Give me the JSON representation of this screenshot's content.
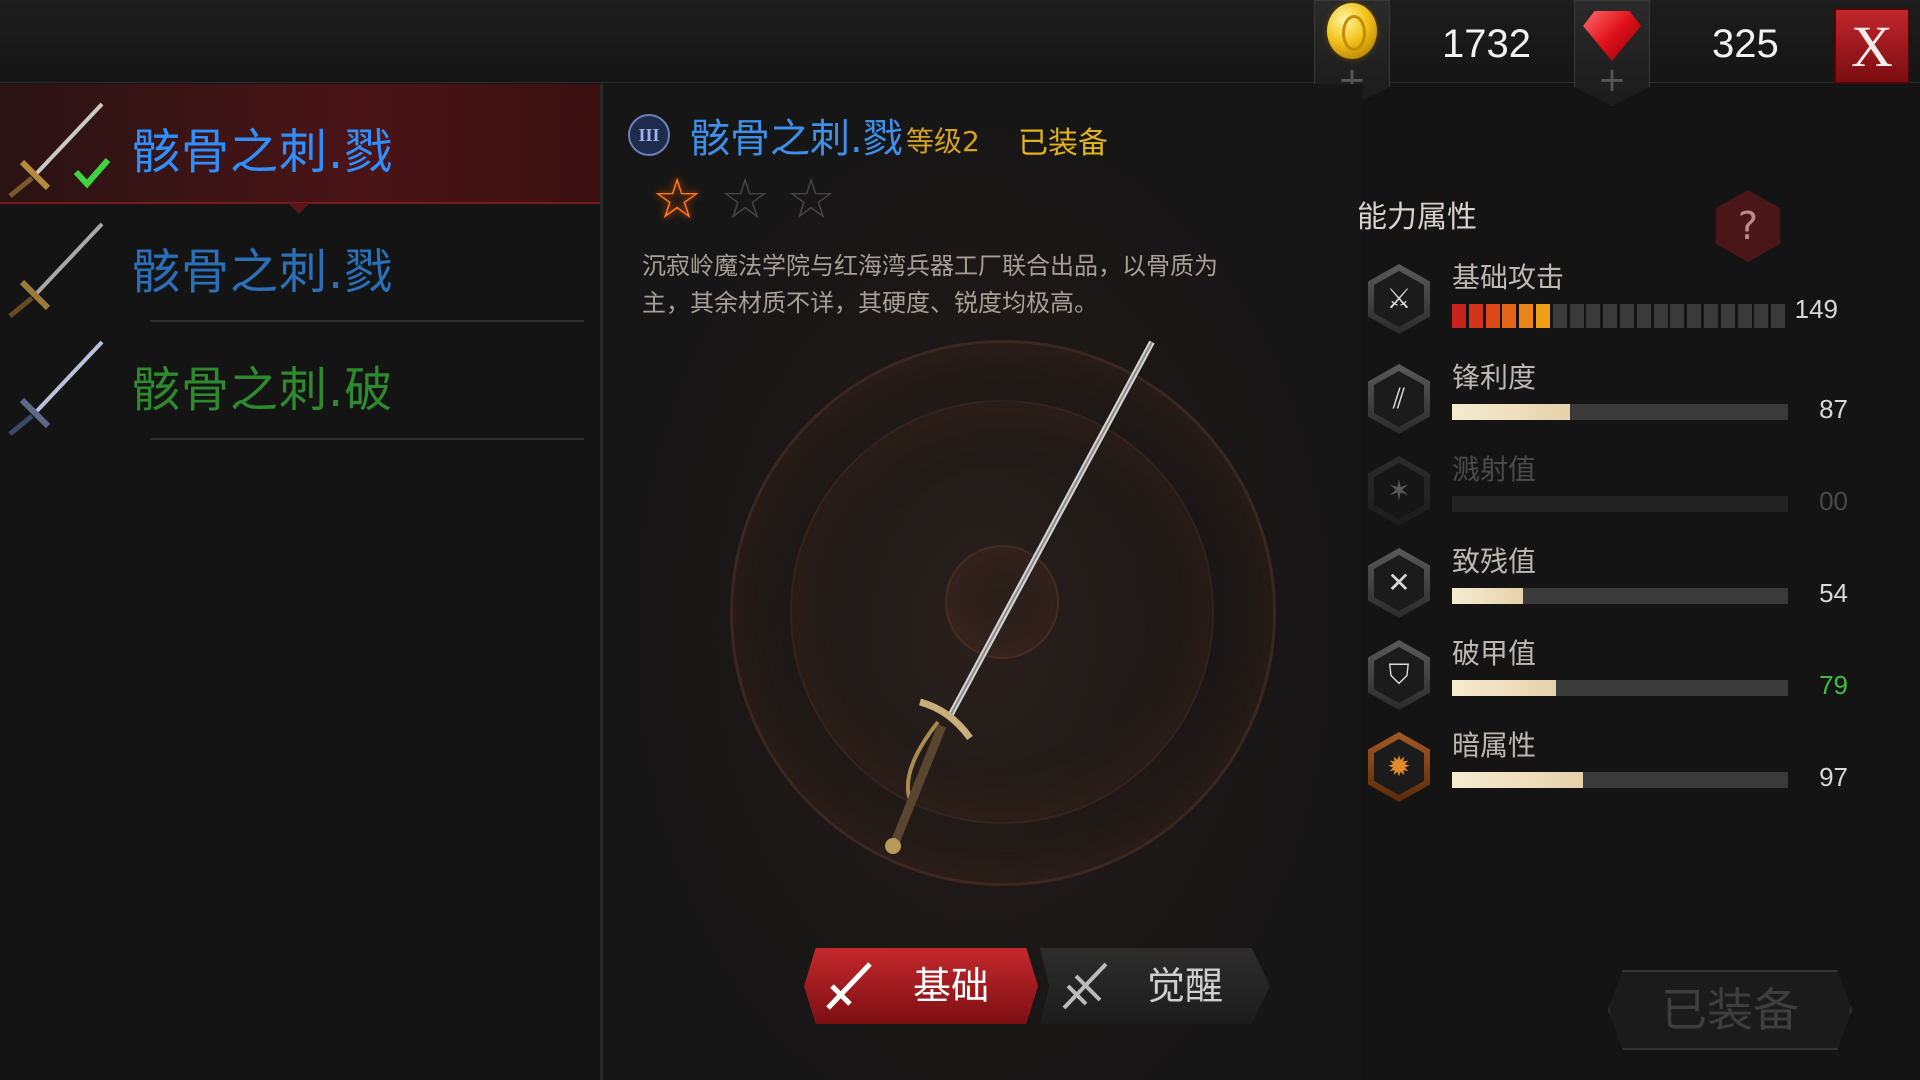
{
  "currency": {
    "gold": "1732",
    "gems": "325",
    "plus_symbol": "+",
    "close_label": "X"
  },
  "weapon_list": [
    {
      "name": "骸骨之刺.戮",
      "color": "#2f8fff",
      "selected": true,
      "equipped": true
    },
    {
      "name": "骸骨之刺.戮",
      "color": "#2a6fb8",
      "selected": false,
      "equipped": false
    },
    {
      "name": "骸骨之刺.破",
      "color": "#2e8a2e",
      "selected": false,
      "equipped": false
    }
  ],
  "detail": {
    "tier_badge": "III",
    "name": "骸骨之刺.戮",
    "level": "等级2",
    "status": "已装备",
    "stars_total": 3,
    "stars_filled": 1,
    "description": "沉寂岭魔法学院与红海湾兵器工厂联合出品，以骨质为主，其余材质不详，其硬度、锐度均极高。"
  },
  "attributes": {
    "title": "能力属性",
    "help_symbol": "?",
    "stats": [
      {
        "name": "基础攻击",
        "value": "149",
        "segments_total": 20,
        "segments_filled": 6,
        "icon": "attack-icon",
        "value_color": "#d8d8d8"
      },
      {
        "name": "锋利度",
        "value": "87",
        "fill": 0.35,
        "icon": "sharpness-icon",
        "value_color": "#d8d8d8"
      },
      {
        "name": "溅射值",
        "value": "00",
        "fill": 0,
        "icon": "splash-icon",
        "dim": true,
        "value_color": "#4a4a4a"
      },
      {
        "name": "致残值",
        "value": "54",
        "fill": 0.21,
        "icon": "cripple-icon",
        "value_color": "#d8d8d8"
      },
      {
        "name": "破甲值",
        "value": "79",
        "fill": 0.31,
        "icon": "armor-break-icon",
        "value_color": "#3fbf3f"
      },
      {
        "name": "暗属性",
        "value": "97",
        "fill": 0.39,
        "icon": "dark-element-icon",
        "value_color": "#d8d8d8"
      }
    ]
  },
  "tabs": {
    "basic": "基础",
    "awaken": "觉醒"
  },
  "equip_button": "已装备"
}
